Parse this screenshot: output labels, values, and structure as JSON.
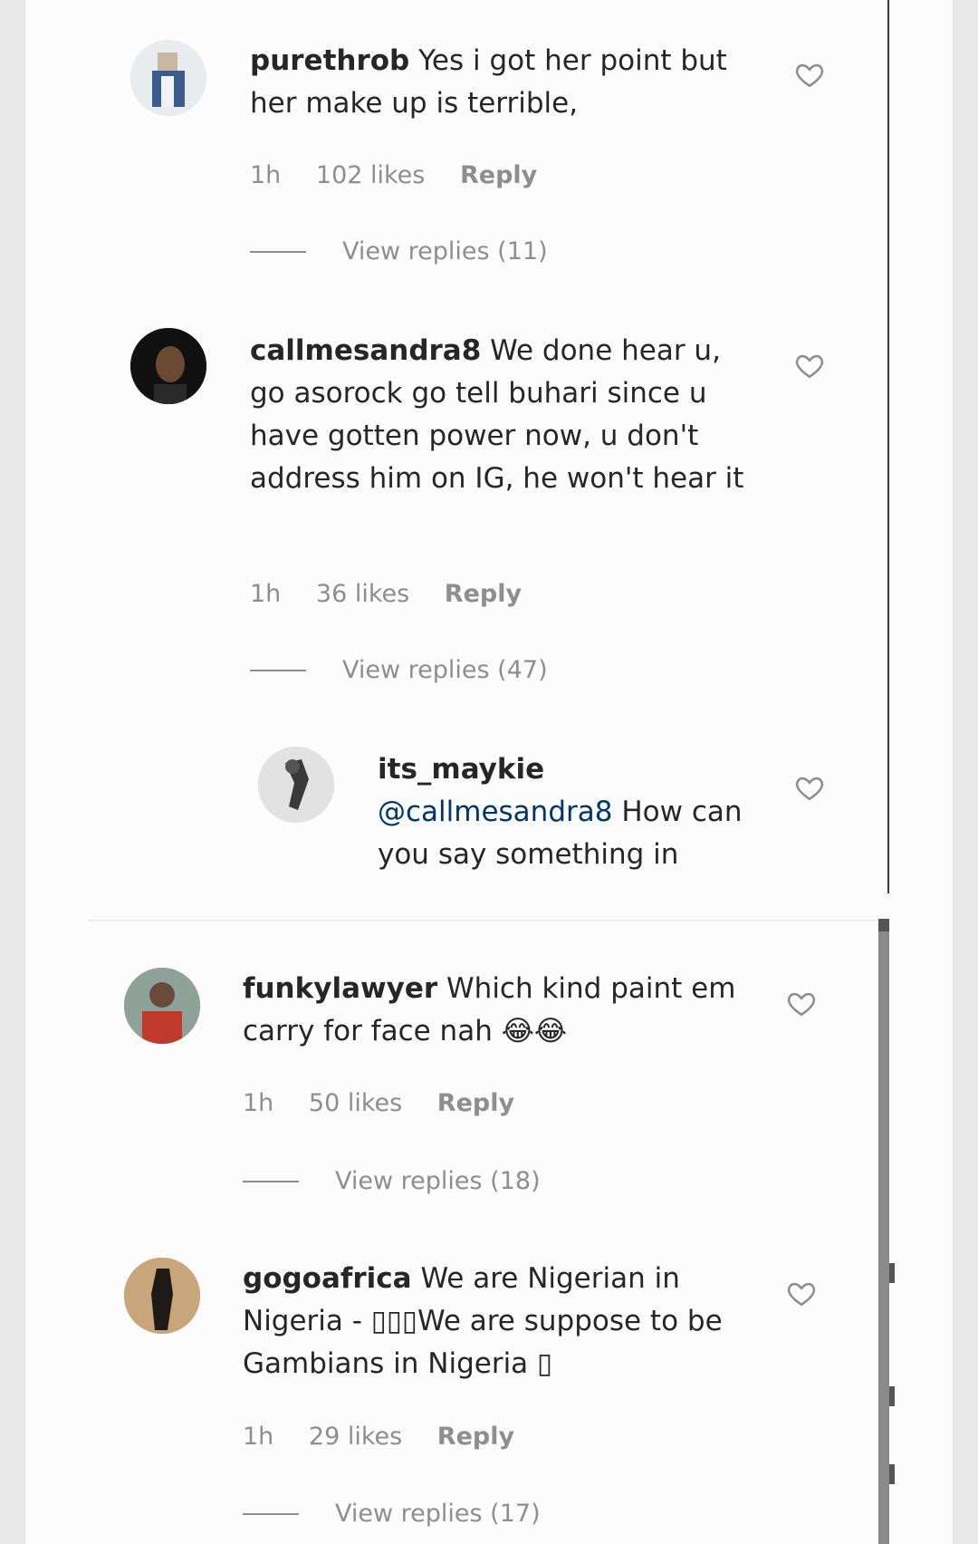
{
  "comments": [
    {
      "username": "purethrob",
      "text": "Yes i got her point but her make up is terrible,",
      "time": "1h",
      "likes": "102 likes",
      "reply": "Reply",
      "view_replies": "View replies (11)"
    },
    {
      "username": "callmesandra8",
      "text": "We done hear u, go asorock go tell buhari since u have gotten power now, u don't address him on IG, he won't hear it",
      "time": "1h",
      "likes": "36 likes",
      "reply": "Reply",
      "view_replies": "View replies (47)"
    },
    {
      "username": "funkylawyer",
      "text": "Which kind paint em carry for face nah 😂😂",
      "time": "1h",
      "likes": "50 likes",
      "reply": "Reply",
      "view_replies": "View replies (18)"
    },
    {
      "username": "gogoafrica",
      "text": "We are Nigerian in Nigeria - ▯▯▯We are suppose to be Gambians in Nigeria ▯",
      "time": "1h",
      "likes": "29 likes",
      "reply": "Reply",
      "view_replies": "View replies (17)"
    }
  ],
  "nested_reply": {
    "username": "its_maykie",
    "mention": "@callmesandra8",
    "text": "How can you say something in"
  },
  "icons": {
    "like": "heart-outline-icon",
    "avatar": "profile-avatar"
  },
  "colors": {
    "text": "#262626",
    "meta": "#8e8e8e",
    "mention": "#00376b",
    "background": "#fcfcfc"
  }
}
